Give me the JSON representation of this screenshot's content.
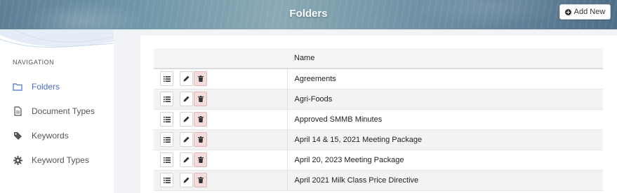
{
  "header": {
    "title": "Folders",
    "add_button_label": "Add New"
  },
  "sidebar": {
    "heading": "NAVIGATION",
    "items": [
      {
        "label": "Folders",
        "icon": "folder-icon",
        "active": true
      },
      {
        "label": "Document Types",
        "icon": "document-icon",
        "active": false
      },
      {
        "label": "Keywords",
        "icon": "tag-icon",
        "active": false
      },
      {
        "label": "Keyword Types",
        "icon": "gear-icon",
        "active": false
      }
    ]
  },
  "table": {
    "columns": [
      "",
      "Name"
    ],
    "rows": [
      {
        "name": "Agreements"
      },
      {
        "name": "Agri-Foods"
      },
      {
        "name": "Approved SMMB Minutes"
      },
      {
        "name": "April 14 & 15, 2021 Meeting Package"
      },
      {
        "name": "April 20, 2023 Meeting Package"
      },
      {
        "name": "April 2021 Milk Class Price Directive"
      }
    ]
  },
  "colors": {
    "accent": "#4a6fc4",
    "delete_bg": "#f4dcdc"
  }
}
